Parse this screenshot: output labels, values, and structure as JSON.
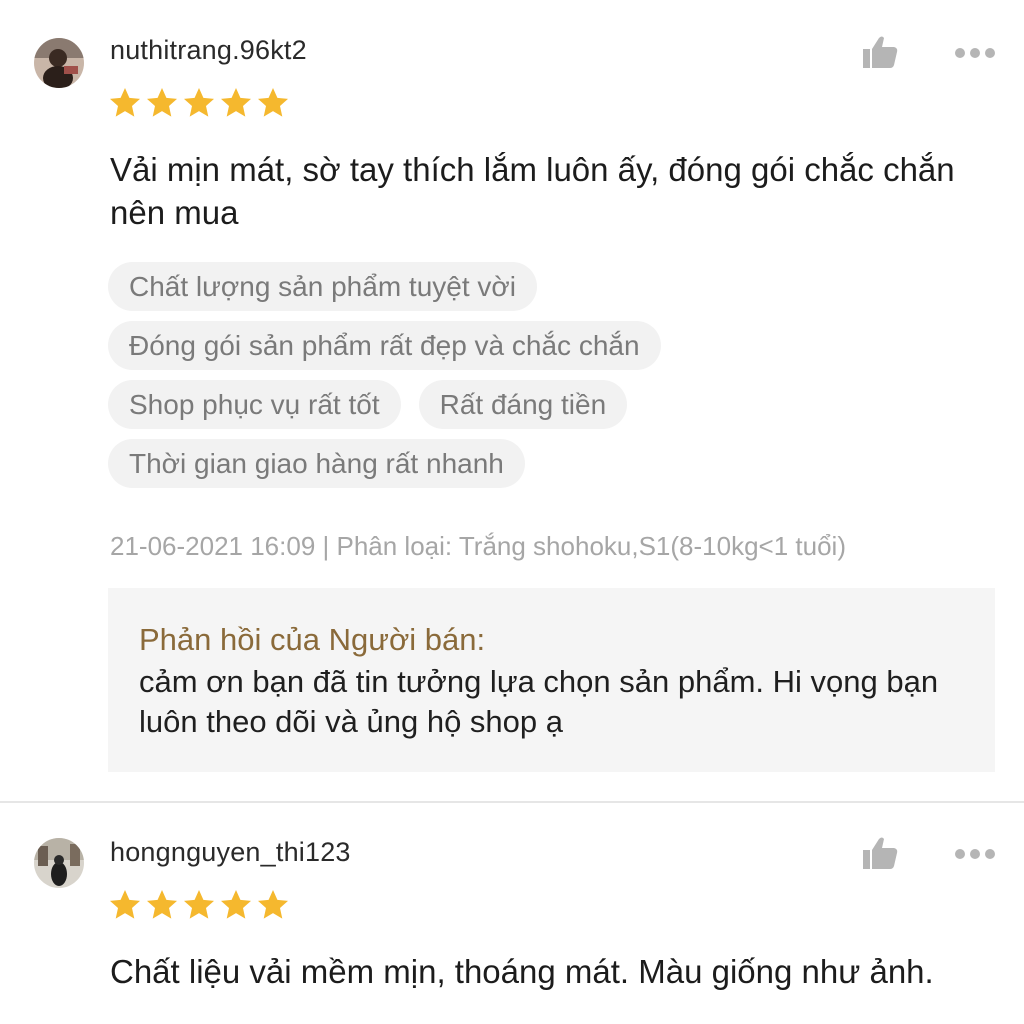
{
  "reviews": [
    {
      "username": "nuthitrang.96kt2",
      "rating": 5,
      "text": "Vải mịn mát, sờ tay thích lắm luôn ấy, đóng gói chắc chắn nên mua",
      "tags": [
        "Chất lượng sản phẩm tuyệt vời",
        "Đóng gói sản phẩm rất đẹp và chắc chắn",
        "Shop phục vụ rất tốt",
        "Rất đáng tiền",
        "Thời gian giao hàng rất nhanh"
      ],
      "meta": "21-06-2021 16:09 | Phân loại: Trắng shohoku,S1(8-10kg<1 tuổi)",
      "seller_reply": {
        "title": "Phản hồi của Người bán:",
        "text": "cảm ơn bạn đã tin tưởng lựa chọn sản phẩm. Hi vọng bạn luôn theo dõi và ủng hộ shop ạ"
      }
    },
    {
      "username": "hongnguyen_thi123",
      "rating": 5,
      "text": "Chất liệu vải mềm mịn, thoáng mát. Màu giống như ảnh."
    }
  ],
  "icons": {
    "like": "thumbs-up-icon",
    "more": "more-options-icon",
    "star": "star-icon"
  },
  "colors": {
    "star": "#F5B82E",
    "seller_title": "#8A6A3A",
    "icon_gray": "#B5B5B5",
    "tag_bg": "#F2F2F2"
  }
}
